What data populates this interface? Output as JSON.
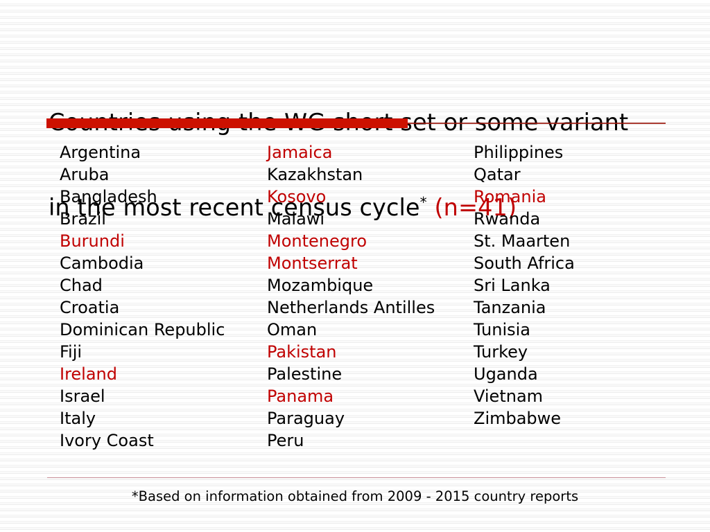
{
  "slide": {
    "title_line_1": "Countries using the WG short set or some variant",
    "title_line_2_prefix": "in the most recent census cycle",
    "title_superscript": "*",
    "title_count": "(n=41)",
    "footnote": "*Based on information obtained from 2009 - 2015 country reports"
  },
  "colors": {
    "highlight_red": "#C00000",
    "divider_red": "#CC1100",
    "divider_line": "#9E1B10",
    "footnote_rule": "#C9909A",
    "text_black": "#000000"
  },
  "columns": [
    {
      "name": "column-1",
      "items": [
        {
          "label": "Argentina",
          "highlighted": false
        },
        {
          "label": "Aruba",
          "highlighted": false
        },
        {
          "label": "Bangladesh",
          "highlighted": false
        },
        {
          "label": "Brazil",
          "highlighted": false
        },
        {
          "label": "Burundi",
          "highlighted": true
        },
        {
          "label": "Cambodia",
          "highlighted": false
        },
        {
          "label": "Chad",
          "highlighted": false
        },
        {
          "label": "Croatia",
          "highlighted": false
        },
        {
          "label": "Dominican Republic",
          "highlighted": false
        },
        {
          "label": "Fiji",
          "highlighted": false
        },
        {
          "label": "Ireland",
          "highlighted": true
        },
        {
          "label": "Israel",
          "highlighted": false
        },
        {
          "label": "Italy",
          "highlighted": false
        },
        {
          "label": "Ivory Coast",
          "highlighted": false
        }
      ]
    },
    {
      "name": "column-2",
      "items": [
        {
          "label": "Jamaica",
          "highlighted": true
        },
        {
          "label": "Kazakhstan",
          "highlighted": false
        },
        {
          "label": "Kosovo",
          "highlighted": true
        },
        {
          "label": "Malawi",
          "highlighted": false
        },
        {
          "label": "Montenegro",
          "highlighted": true
        },
        {
          "label": "Montserrat",
          "highlighted": true
        },
        {
          "label": "Mozambique",
          "highlighted": false
        },
        {
          "label": "Netherlands Antilles",
          "highlighted": false
        },
        {
          "label": "Oman",
          "highlighted": false
        },
        {
          "label": "Pakistan",
          "highlighted": true
        },
        {
          "label": "Palestine",
          "highlighted": false
        },
        {
          "label": "Panama",
          "highlighted": true
        },
        {
          "label": "Paraguay",
          "highlighted": false
        },
        {
          "label": "Peru",
          "highlighted": false
        }
      ]
    },
    {
      "name": "column-3",
      "items": [
        {
          "label": "Philippines",
          "highlighted": false
        },
        {
          "label": "Qatar",
          "highlighted": false
        },
        {
          "label": "Romania",
          "highlighted": true
        },
        {
          "label": "Rwanda",
          "highlighted": false
        },
        {
          "label": "St. Maarten",
          "highlighted": false
        },
        {
          "label": "South Africa",
          "highlighted": false
        },
        {
          "label": "Sri Lanka",
          "highlighted": false
        },
        {
          "label": "Tanzania",
          "highlighted": false
        },
        {
          "label": "Tunisia",
          "highlighted": false
        },
        {
          "label": "Turkey",
          "highlighted": false
        },
        {
          "label": "Uganda",
          "highlighted": false
        },
        {
          "label": "Vietnam",
          "highlighted": false
        },
        {
          "label": "Zimbabwe",
          "highlighted": false
        }
      ]
    }
  ]
}
